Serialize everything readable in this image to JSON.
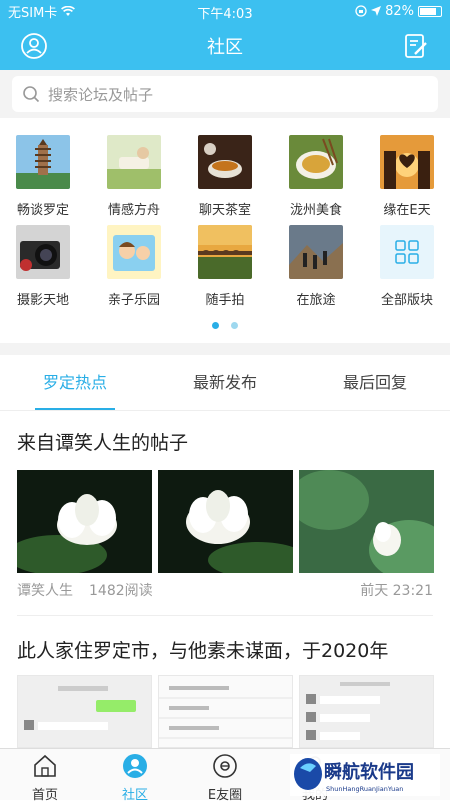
{
  "status": {
    "carrier": "无SIM卡",
    "time": "下午4:03",
    "battery": "82%",
    "battery_level": 0.82
  },
  "header": {
    "title": "社区",
    "left_icon": "user-icon",
    "right_icon": "edit-icon"
  },
  "search": {
    "placeholder": "搜索论坛及帖子"
  },
  "grid": {
    "items": [
      {
        "label": "畅谈罗定"
      },
      {
        "label": "情感方舟"
      },
      {
        "label": "聊天茶室"
      },
      {
        "label": "泷州美食"
      },
      {
        "label": "缘在E天"
      },
      {
        "label": "摄影天地"
      },
      {
        "label": "亲子乐园"
      },
      {
        "label": "随手拍"
      },
      {
        "label": "在旅途"
      },
      {
        "label": "全部版块"
      }
    ]
  },
  "tabs": [
    {
      "label": "罗定热点",
      "active": true
    },
    {
      "label": "最新发布",
      "active": false
    },
    {
      "label": "最后回复",
      "active": false
    }
  ],
  "posts": [
    {
      "title": "来自谭笑人生的帖子",
      "author": "谭笑人生",
      "reads": "1482阅读",
      "time": "前天 23:21"
    },
    {
      "title": "此人家住罗定市，与他素未谋面，于2020年"
    }
  ],
  "nav": [
    {
      "label": "首页",
      "active": false
    },
    {
      "label": "社区",
      "active": true
    },
    {
      "label": "E友圈",
      "active": false
    },
    {
      "label": "我的",
      "active": false
    }
  ],
  "watermark": {
    "text": "瞬航软件园",
    "subtext": "ShunHangRuanJianYuan"
  },
  "colors": {
    "accent": "#29aee6",
    "header": "#3cc0f0"
  }
}
